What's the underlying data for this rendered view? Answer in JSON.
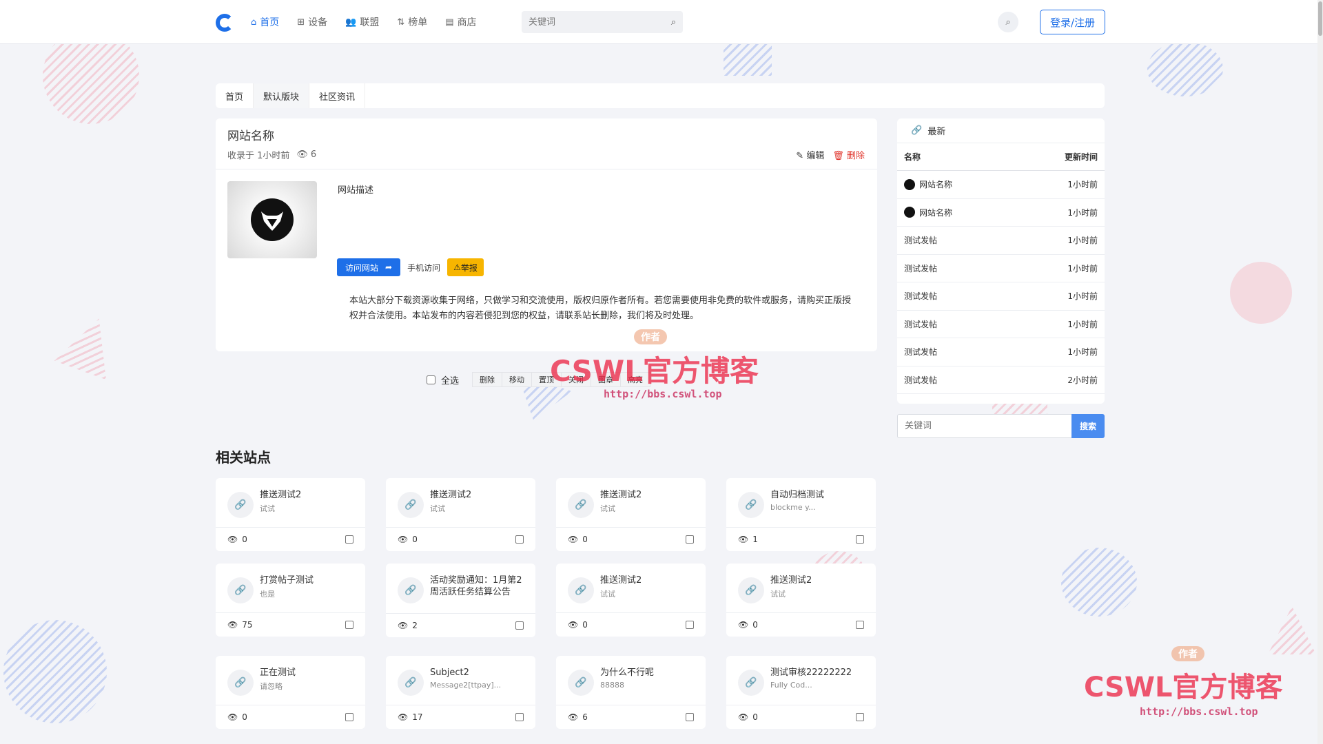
{
  "header": {
    "nav": [
      {
        "label": "首页",
        "icon": "home-icon",
        "active": true
      },
      {
        "label": "设备",
        "icon": "grid-icon",
        "active": false
      },
      {
        "label": "联盟",
        "icon": "users-icon",
        "active": false
      },
      {
        "label": "榜单",
        "icon": "sort-icon",
        "active": false
      },
      {
        "label": "商店",
        "icon": "store-icon",
        "active": false
      }
    ],
    "search_placeholder": "关键词",
    "login_label": "登录/注册",
    "accent_color": "#1e6fe8"
  },
  "breadcrumb": [
    "首页",
    "默认版块",
    "社区资讯"
  ],
  "site": {
    "title": "网站名称",
    "collected": "收录于 1小时前",
    "views": "6",
    "edit_label": "编辑",
    "delete_label": "删除",
    "description": "网站描述",
    "visit_label": "访问网站",
    "mobile_label": "手机访问",
    "report_label": "举报",
    "disclaimer": "本站大部分下载资源收集于网络，只做学习和交流使用，版权归原作者所有。若您需要使用非免费的软件或服务，请购买正版授权并合法使用。本站发布的内容若侵犯到您的权益，请联系站长删除，我们将及时处理。"
  },
  "toolbar": {
    "select_all": "全选",
    "buttons": [
      "删除",
      "移动",
      "置顶",
      "关闭",
      "图章",
      "高亮"
    ]
  },
  "watermark": {
    "tag": "作者",
    "text": "CSWL官方博客",
    "url": "http://bbs.cswl.top"
  },
  "related": {
    "title": "相关站点",
    "items": [
      {
        "name": "推送测试2",
        "sub": "试试",
        "views": "0"
      },
      {
        "name": "推送测试2",
        "sub": "试试",
        "views": "0"
      },
      {
        "name": "推送测试2",
        "sub": "试试",
        "views": "0"
      },
      {
        "name": "自动归档测试",
        "sub": "blockme  y...",
        "views": "1"
      },
      {
        "name": "打赏帖子测试",
        "sub": "也是",
        "views": "75"
      },
      {
        "name": "活动奖励通知：1月第2周活跃任务结算公告",
        "sub": "",
        "views": "2"
      },
      {
        "name": "推送测试2",
        "sub": "试试",
        "views": "0"
      },
      {
        "name": "推送测试2",
        "sub": "试试",
        "views": "0"
      },
      {
        "name": "正在测试",
        "sub": "请忽略",
        "views": "0"
      },
      {
        "name": "Subject2",
        "sub": "Message2[ttpay]...",
        "views": "17"
      },
      {
        "name": "为什么不行呢",
        "sub": "88888",
        "views": "6"
      },
      {
        "name": "测试审核22222222",
        "sub": "Fully  Cod...",
        "views": "0"
      }
    ]
  },
  "sidebar": {
    "title": "最新",
    "col_name": "名称",
    "col_time": "更新时间",
    "rows": [
      {
        "name": "网站名称",
        "time": "1小时前",
        "logo": true
      },
      {
        "name": "网站名称",
        "time": "1小时前",
        "logo": true
      },
      {
        "name": "测试发帖",
        "time": "1小时前",
        "logo": false
      },
      {
        "name": "测试发帖",
        "time": "1小时前",
        "logo": false
      },
      {
        "name": "测试发帖",
        "time": "1小时前",
        "logo": false
      },
      {
        "name": "测试发帖",
        "time": "1小时前",
        "logo": false
      },
      {
        "name": "测试发帖",
        "time": "1小时前",
        "logo": false
      },
      {
        "name": "测试发帖",
        "time": "2小时前",
        "logo": false
      }
    ],
    "search_placeholder": "关键词",
    "search_button": "搜索"
  }
}
